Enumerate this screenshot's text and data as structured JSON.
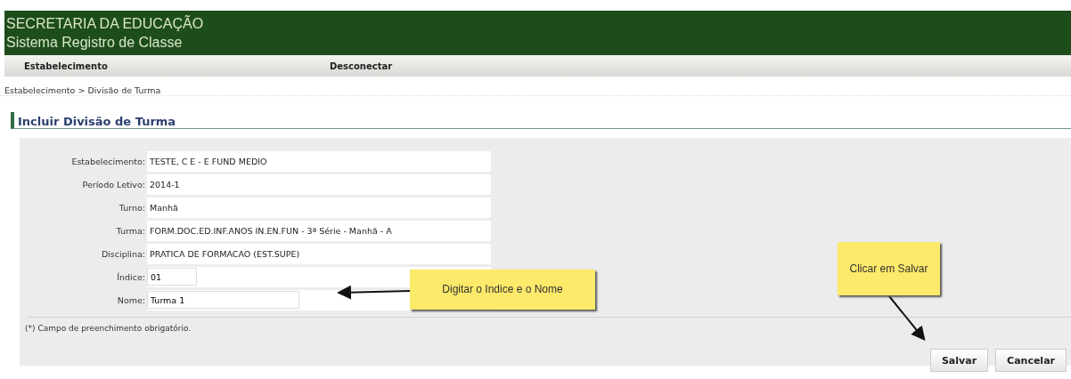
{
  "header": {
    "title": "SECRETARIA DA EDUCAÇÃO",
    "subtitle": "Sistema Registro de Classe"
  },
  "menu": [
    "Estabelecimento",
    "Desconectar"
  ],
  "breadcrumb": "Estabelecimento > Divisão de Turma",
  "page_title": "Incluir Divisão de Turma",
  "fields": [
    {
      "kind": "text",
      "label": "Estabelecimento:",
      "value": "TESTE, C E - E FUND MEDIO"
    },
    {
      "kind": "text",
      "label": "Período Letivo:",
      "value": "2014-1"
    },
    {
      "kind": "text",
      "label": "Turno:",
      "value": "Manhã"
    },
    {
      "kind": "text",
      "label": "Turma:",
      "value": "FORM.DOC.ED.INF.ANOS IN.EN.FUN - 3ª Série - Manhã - A"
    },
    {
      "kind": "text",
      "label": "Disciplina:",
      "value": "PRATICA DE FORMACAO (EST.SUPE)"
    },
    {
      "kind": "short_input",
      "label": "Índice:",
      "value": "01"
    },
    {
      "kind": "input",
      "label": "Nome:",
      "value": "Turma 1"
    }
  ],
  "note": "(*) Campo de preenchimento obrigatório.",
  "callouts": [
    "Digitar o Indice e o Nome",
    "Clicar em Salvar"
  ],
  "buttons": [
    "Salvar",
    "Cancelar"
  ]
}
